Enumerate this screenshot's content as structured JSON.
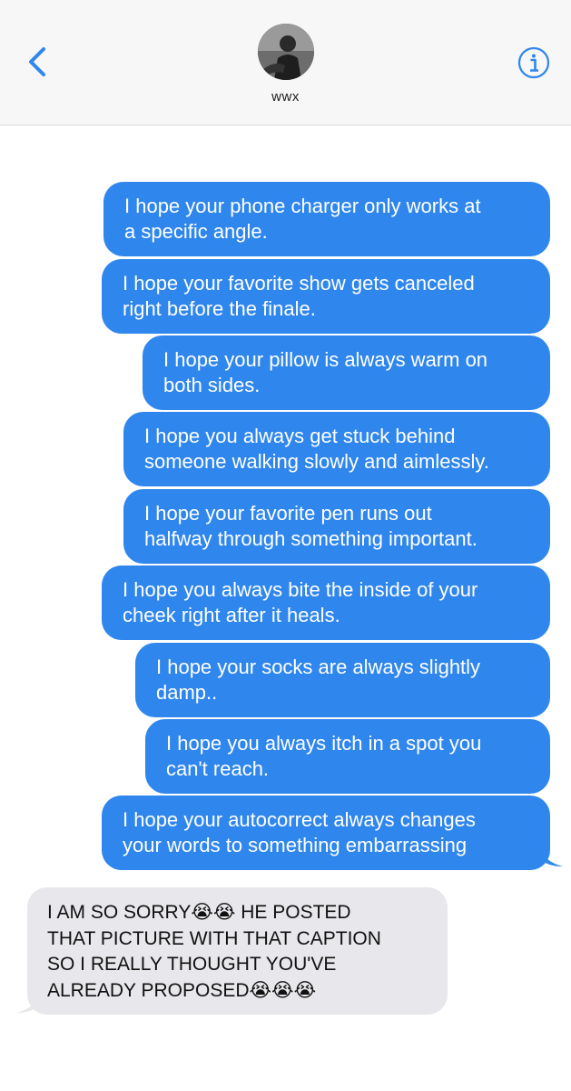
{
  "header": {
    "contact_name": "wwx",
    "back_icon": "chevron-left-icon",
    "info_icon": "info-icon"
  },
  "colors": {
    "outgoing_bubble": "#2f86ed",
    "incoming_bubble": "#e8e8ec",
    "accent": "#2f86ed"
  },
  "messages": {
    "outgoing": [
      "I hope your phone charger only works at\na specific angle.",
      "I hope your favorite show gets canceled\nright before the finale.",
      "I hope your pillow is always warm on\nboth sides.",
      "I hope you always get stuck behind\nsomeone walking slowly and aimlessly.",
      "I hope your favorite pen runs out\nhalfway through something important.",
      "I hope you always bite the inside of your\ncheek right after it heals.",
      "I hope your socks are always slightly\ndamp..",
      "I hope you always itch in a spot you\ncan't reach.",
      "I hope your autocorrect always changes\nyour words to something embarrassing"
    ],
    "incoming": [
      "I AM SO SORRY😭😭 HE POSTED\nTHAT PICTURE WITH THAT CAPTION\nSO I REALLY THOUGHT YOU'VE\nALREADY PROPOSED😭😭😭"
    ]
  }
}
